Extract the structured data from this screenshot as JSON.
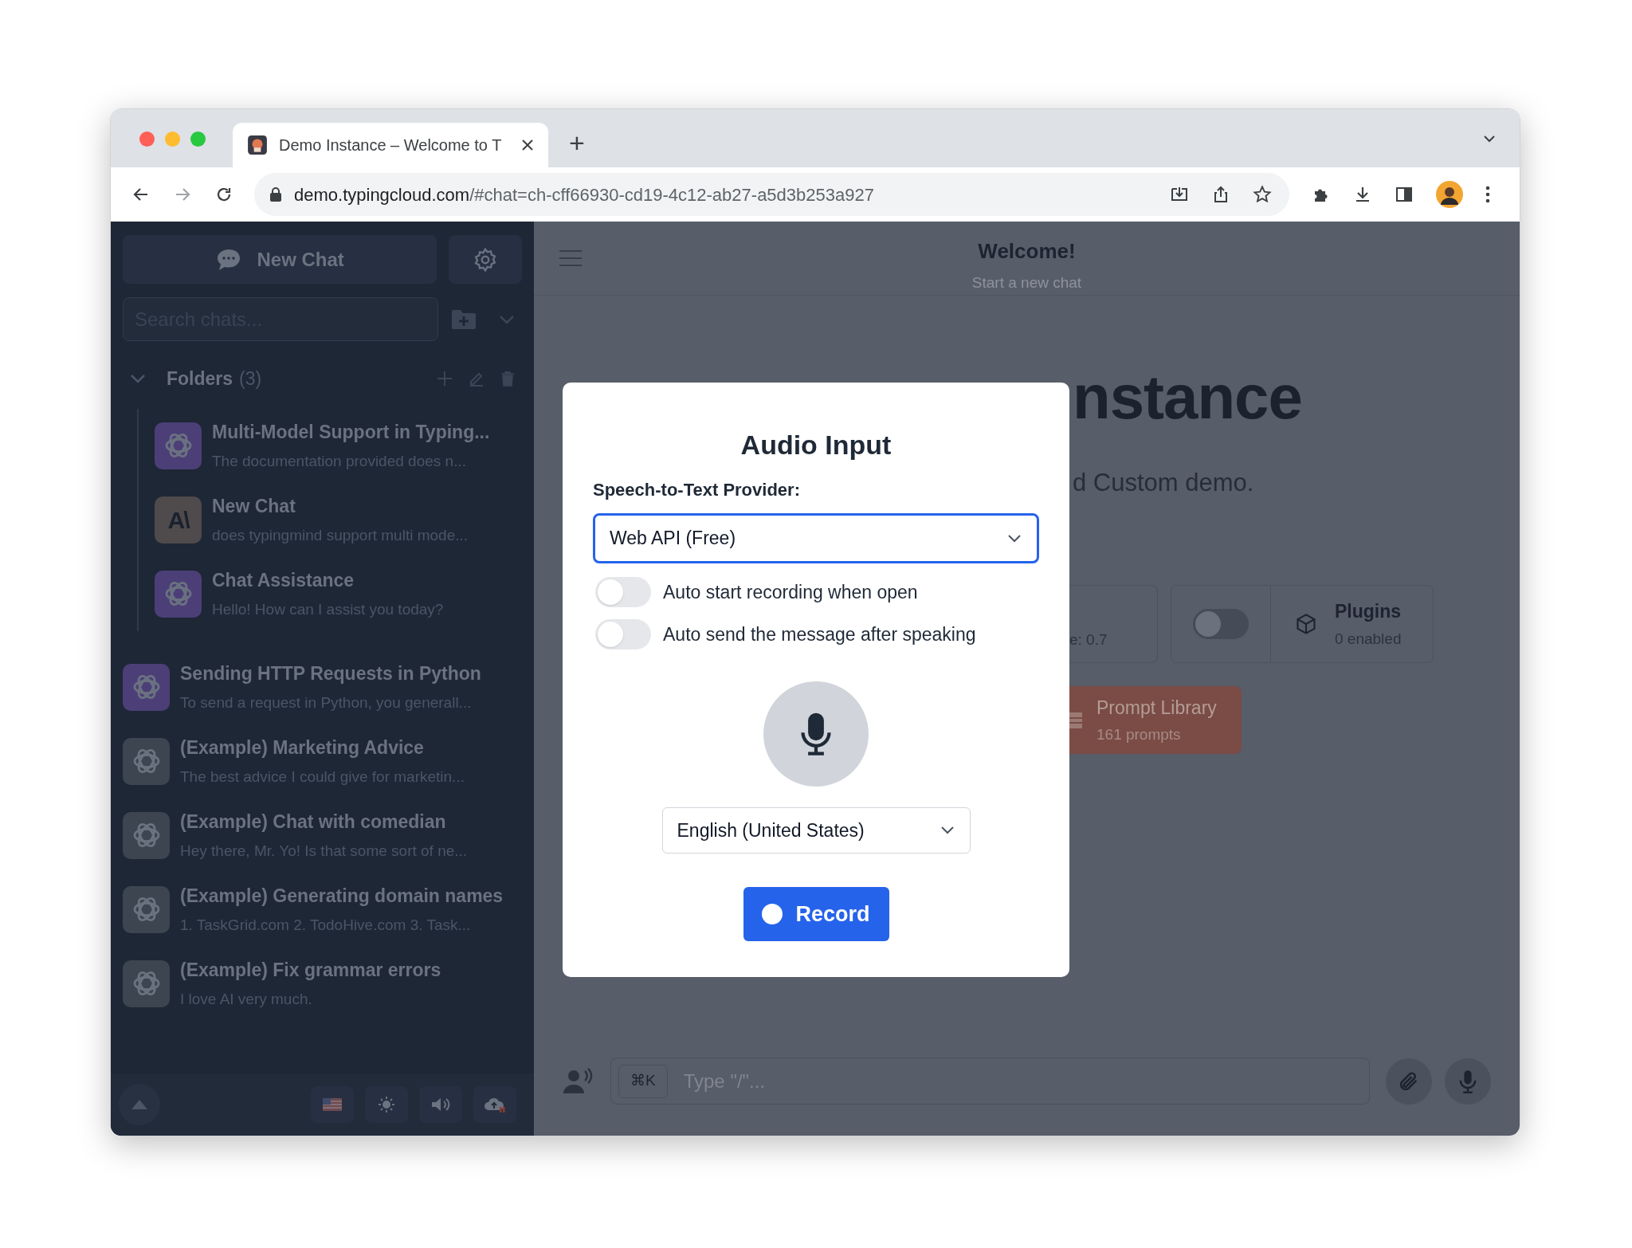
{
  "browser": {
    "tab": {
      "title": "Demo Instance – Welcome to T"
    },
    "new_tab": "+",
    "url": {
      "host": "demo.typingcloud.com",
      "path": "/#chat=ch-cff66930-cd19-4c12-ab27-a5d3b253a927"
    }
  },
  "sidebar": {
    "new_chat": "New Chat",
    "search": {
      "placeholder": "Search chats..."
    },
    "folders": {
      "label": "Folders",
      "count": "(3)",
      "expanded": true,
      "chats": [
        {
          "title": "Multi-Model Support in Typing...",
          "preview": "The documentation provided does n...",
          "kind": "openai",
          "color": "#4c3f78"
        },
        {
          "title": "New Chat",
          "preview": "does typingmind support multi mode...",
          "kind": "anthropic",
          "color": "#4f4a4b",
          "logo": "A\\"
        },
        {
          "title": "Chat Assistance",
          "preview": "Hello! How can I assist you today?",
          "kind": "openai",
          "color": "#4c3f78"
        }
      ]
    },
    "chats": [
      {
        "title": "Sending HTTP Requests in Python",
        "preview": "To send a request in Python, you generall...",
        "kind": "openai",
        "color": "#4c3f78"
      },
      {
        "title": "(Example) Marketing Advice",
        "preview": "The best advice I could give for marketin...",
        "kind": "openai",
        "color": "#3c4550"
      },
      {
        "title": "(Example) Chat with comedian",
        "preview": "Hey there, Mr. Yo! Is that some sort of ne...",
        "kind": "openai",
        "color": "#3c4550"
      },
      {
        "title": "(Example) Generating domain names",
        "preview": "1. TaskGrid.com 2. TodoHive.com 3. Task...",
        "kind": "openai",
        "color": "#3c4550"
      },
      {
        "title": "(Example) Fix grammar errors",
        "preview": "I love AI very much.",
        "kind": "openai",
        "color": "#3c4550"
      }
    ]
  },
  "main": {
    "header": {
      "title": "Welcome!",
      "subtitle": "Start a new chat"
    },
    "title_fragment": "nstance",
    "subtitle_fragment": "d Custom demo.",
    "cards": [
      {
        "kind": "partial",
        "text": "e: 0.7"
      },
      {
        "kind": "plugins",
        "on": false,
        "title": "Plugins",
        "subtitle": "0 enabled"
      }
    ],
    "prompt_library": {
      "title": "Prompt Library",
      "subtitle": "161 prompts"
    },
    "composer": {
      "shortcut": "⌘K",
      "placeholder": "Type \"/\"..."
    }
  },
  "modal": {
    "title": "Audio Input",
    "provider_label": "Speech-to-Text Provider:",
    "provider": "Web API (Free)",
    "toggles": [
      {
        "label": "Auto start recording when open",
        "on": false
      },
      {
        "label": "Auto send the message after speaking",
        "on": false
      }
    ],
    "language": "English (United States)",
    "record": "Record"
  }
}
